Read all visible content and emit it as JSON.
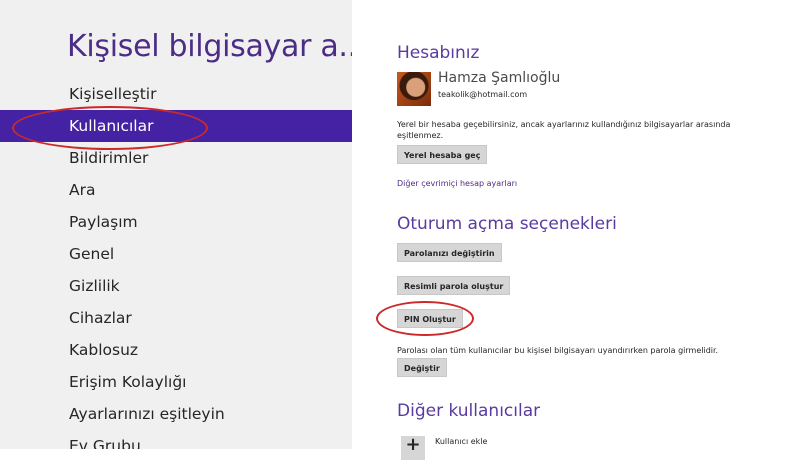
{
  "nav": {
    "title": "Kişisel bilgisayar a...",
    "items": [
      {
        "label": "Kişiselleştir"
      },
      {
        "label": "Kullanıcılar"
      },
      {
        "label": "Bildirimler"
      },
      {
        "label": "Ara"
      },
      {
        "label": "Paylaşım"
      },
      {
        "label": "Genel"
      },
      {
        "label": "Gizlilik"
      },
      {
        "label": "Cihazlar"
      },
      {
        "label": "Kablosuz"
      },
      {
        "label": "Erişim Kolaylığı"
      },
      {
        "label": "Ayarlarınızı eşitleyin"
      },
      {
        "label": "Ev Grubu"
      }
    ],
    "selected_index": 1
  },
  "account": {
    "title": "Hesabınız",
    "user_name": "Hamza Şamlıoğlu",
    "user_email": "teakolik@hotmail.com",
    "switch_text_line1": "Yerel bir hesaba geçebilirsiniz, ancak ayarlarınız kullandığınız bilgisayarlar arasında",
    "switch_text_line2": "eşitlenmez.",
    "switch_button": "Yerel hesaba geç",
    "online_settings_link": "Diğer çevrimiçi hesap ayarları"
  },
  "signin": {
    "title": "Oturum açma seçenekleri",
    "change_password_button": "Parolanızı değiştirin",
    "picture_password_button": "Resimli parola oluştur",
    "pin_button": "PIN Oluştur",
    "password_text": "Parolası olan tüm kullanıcılar bu kişisel bilgisayarı uyandırırken parola girmelidir.",
    "change_button": "Değiştir"
  },
  "other_users": {
    "title": "Diğer kullanıcılar",
    "add_user_label": "Kullanıcı ekle",
    "add_icon": "+"
  },
  "colors": {
    "accent": "#4522a4",
    "title_purple": "#4d2c86",
    "annotation_red": "#cc2a2a"
  }
}
